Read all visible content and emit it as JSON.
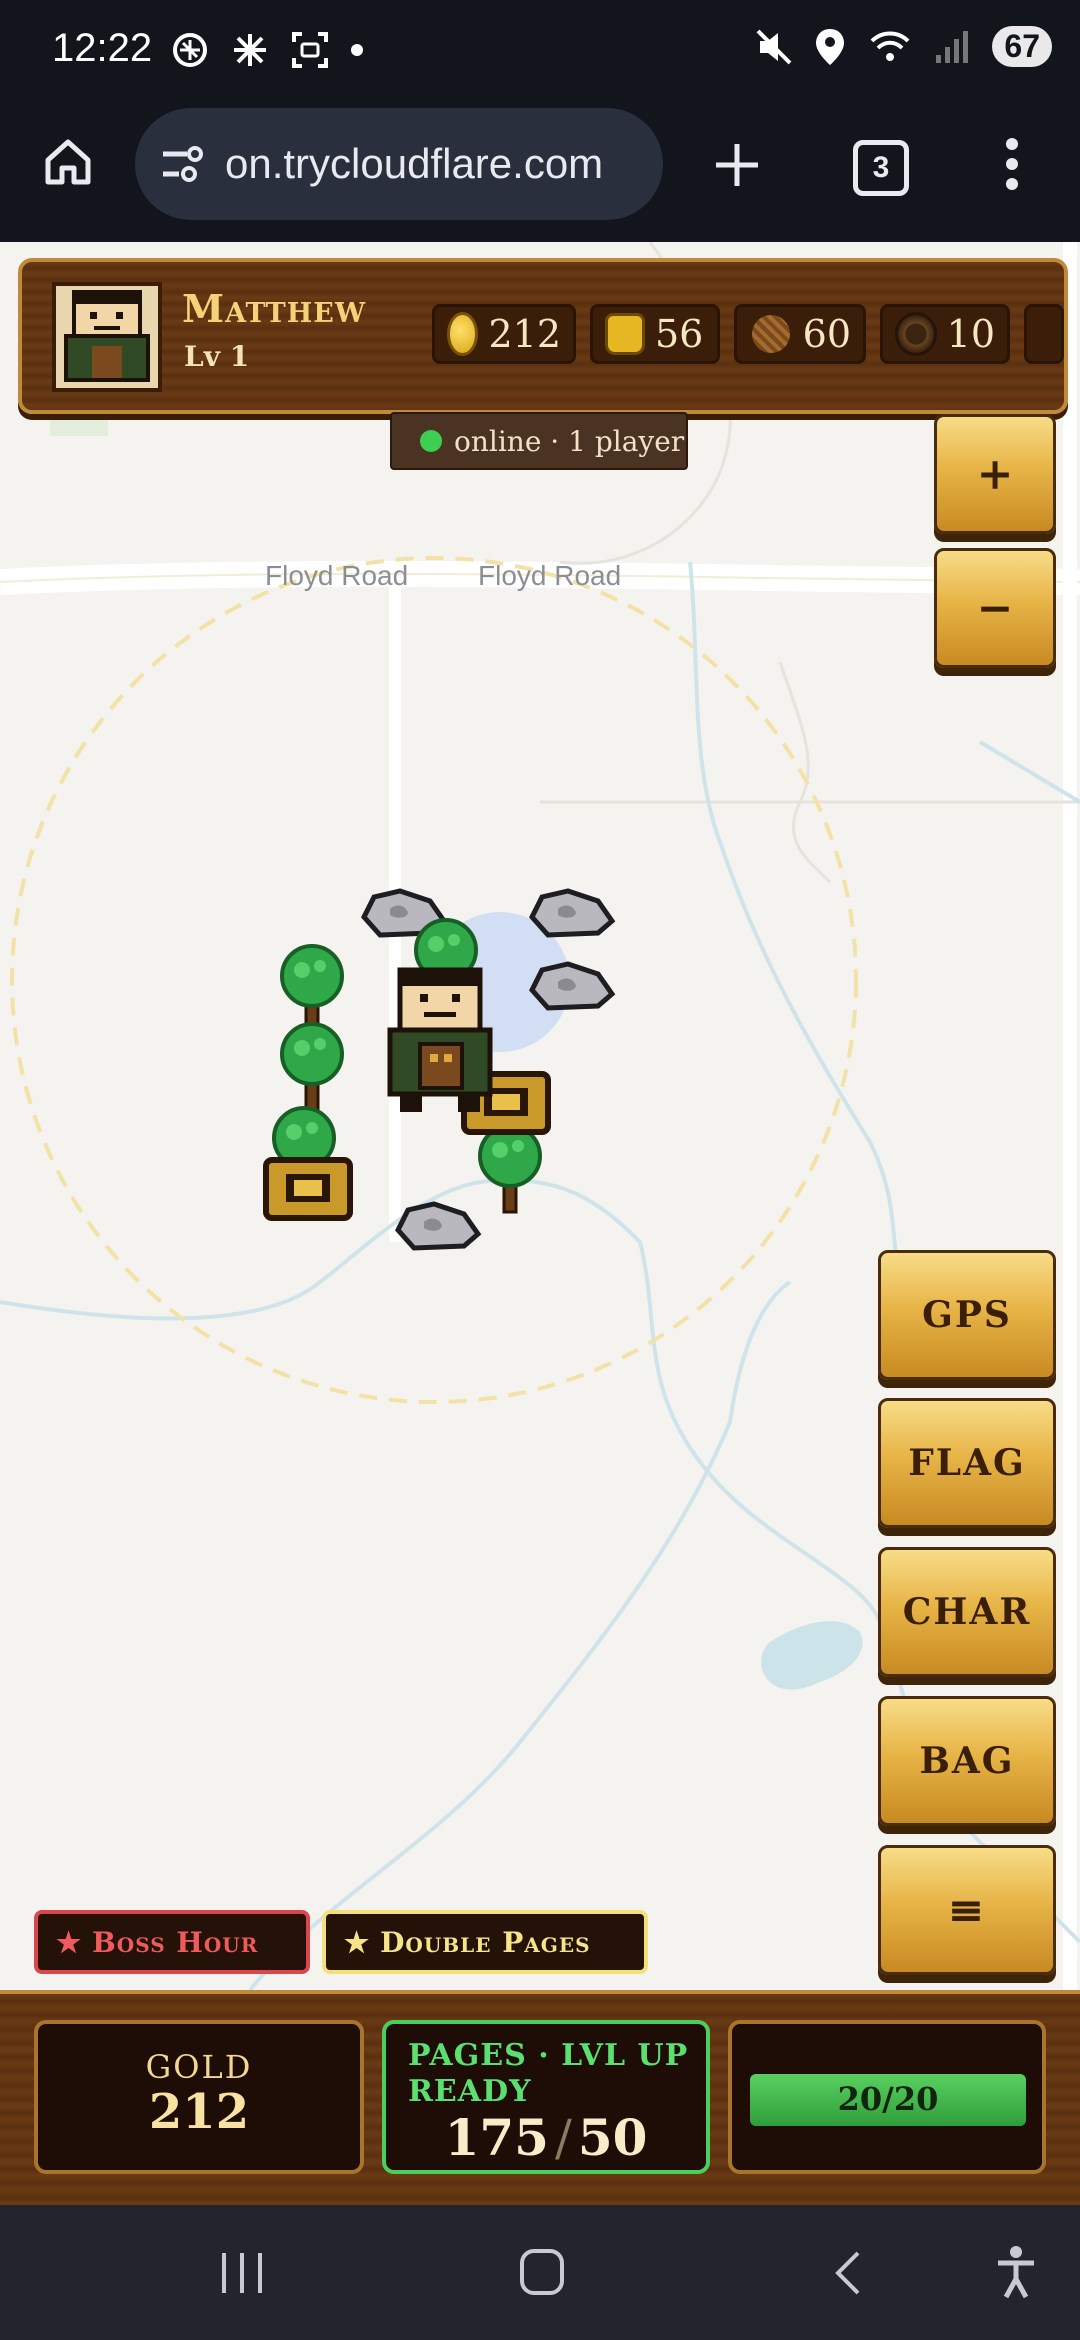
{
  "status_bar": {
    "time": "12:22",
    "battery": "67",
    "network": "6"
  },
  "browser": {
    "url": "on.trycloudflare.com",
    "tab_count": "3"
  },
  "player": {
    "name": "Matthew",
    "level": "Lv 1",
    "resources": [
      {
        "icon": "gold-coin-icon",
        "value": "212"
      },
      {
        "icon": "pages-bag-icon",
        "value": "56"
      },
      {
        "icon": "wood-icon",
        "value": "60"
      },
      {
        "icon": "ore-icon",
        "value": "10"
      }
    ]
  },
  "online": {
    "text": "online · 1 player",
    "color": "#3ccf54"
  },
  "map": {
    "road_labels": [
      "Floyd Road",
      "Floyd Road"
    ],
    "objects": [
      "rock",
      "rock",
      "rock",
      "rock",
      "tree",
      "tree",
      "tree",
      "tree",
      "chest",
      "chest",
      "player-character"
    ]
  },
  "zoom": {
    "in": "+",
    "out": "−"
  },
  "side_buttons": {
    "gps": "GPS",
    "flag": "FLAG",
    "char": "CHAR",
    "bag": "BAG",
    "menu": "≡"
  },
  "events": {
    "boss": "Boss Hour",
    "double": "Double Pages",
    "star": "★"
  },
  "bottom": {
    "gold_label": "GOLD",
    "gold_value": "212",
    "pages_label": "PAGES · LVL UP READY",
    "pages_current": "175",
    "pages_slash": "/",
    "pages_target": "50",
    "hp_text": "20/20",
    "hp_fraction": 1.0
  },
  "colors": {
    "wood": "#5f3411",
    "gold_button": "#e7b446",
    "boss": "#d9474a",
    "double": "#f3e07a",
    "pages_ready": "#4ccf5a"
  }
}
